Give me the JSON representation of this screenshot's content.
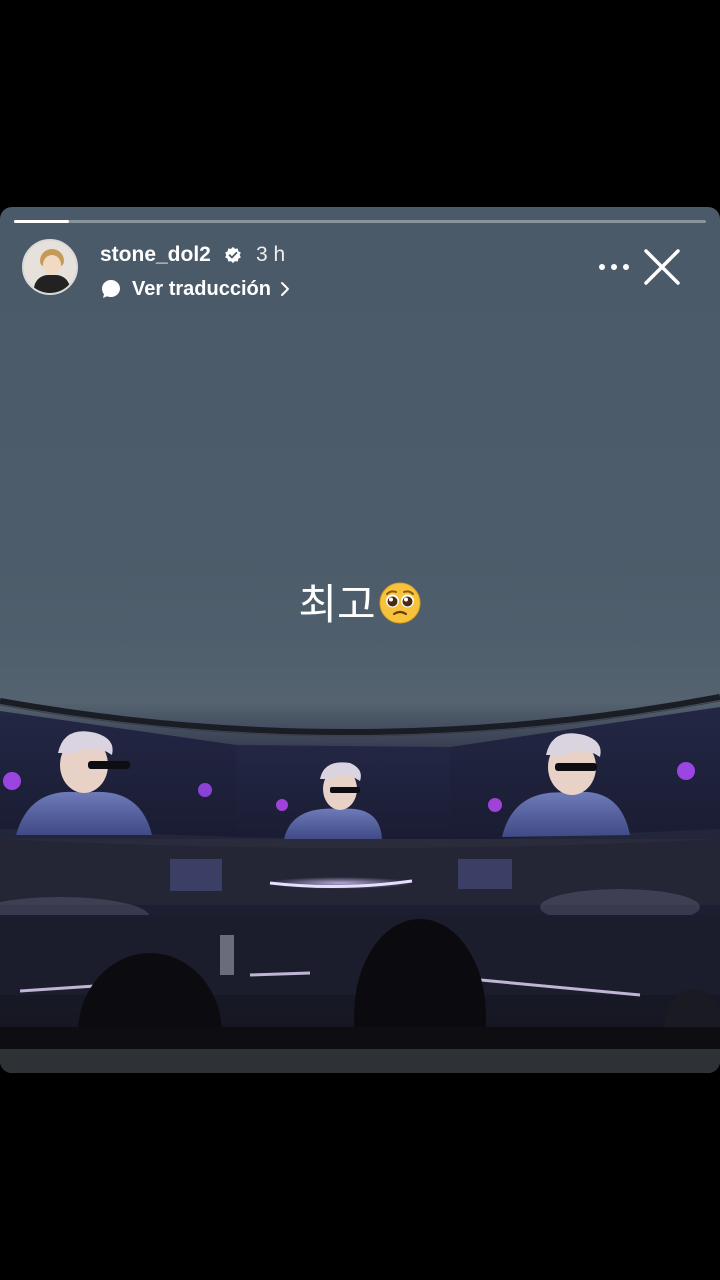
{
  "story": {
    "progress_fraction": 0.08,
    "header": {
      "username": "stone_dol2",
      "time_ago": "3 h",
      "translate_label": "Ver traducción"
    },
    "caption": {
      "text": "최고",
      "emoji_icon": "pleading-face-icon"
    },
    "photo": {
      "icon": "concert-stage-photo"
    }
  }
}
